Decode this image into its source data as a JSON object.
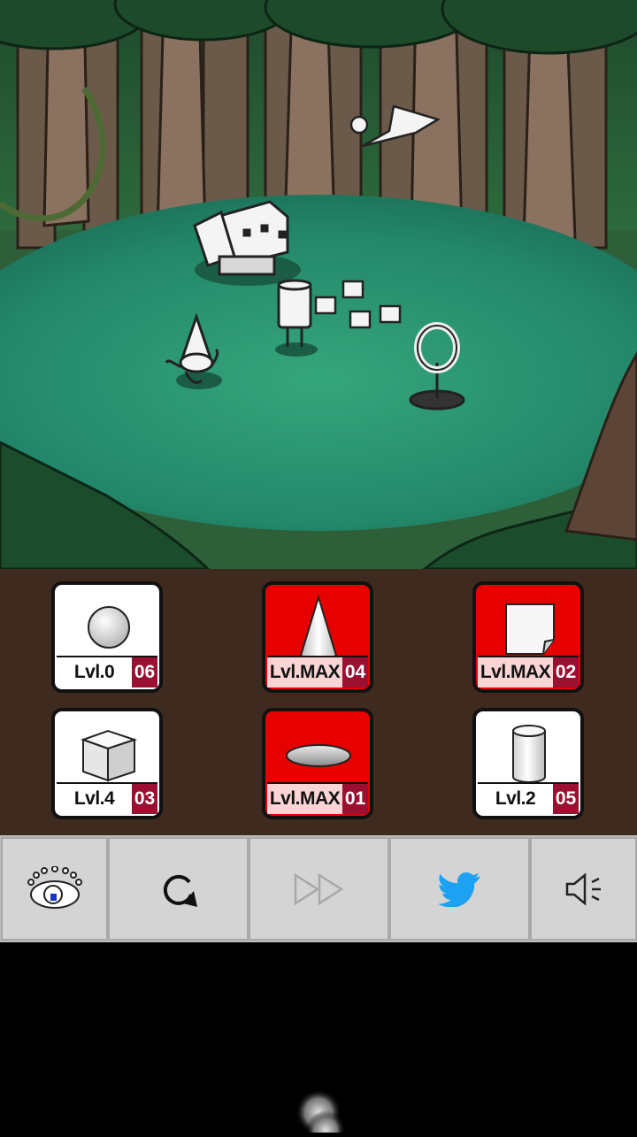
{
  "colors": {
    "panel_bg": "#3f2a1f",
    "card_max_bg": "#e60000",
    "count_badge": "#9b1030",
    "toolbar_bg": "#d4d4d4",
    "twitter_blue": "#1da1f2",
    "forest_floor": "#2a8f6a"
  },
  "shapes": [
    {
      "shape": "sphere",
      "level": "Lvl.0",
      "count": "06",
      "maxed": false
    },
    {
      "shape": "cone",
      "level": "Lvl.MAX",
      "count": "04",
      "maxed": true
    },
    {
      "shape": "paper",
      "level": "Lvl.MAX",
      "count": "02",
      "maxed": true
    },
    {
      "shape": "cube",
      "level": "Lvl.4",
      "count": "03",
      "maxed": false
    },
    {
      "shape": "disc",
      "level": "Lvl.MAX",
      "count": "01",
      "maxed": true
    },
    {
      "shape": "cylinder",
      "level": "Lvl.2",
      "count": "05",
      "maxed": false
    }
  ],
  "toolbar": {
    "buttons": [
      {
        "icon": "eye-logo-icon"
      },
      {
        "icon": "restart-icon"
      },
      {
        "icon": "fast-forward-icon",
        "disabled": true
      },
      {
        "icon": "twitter-icon"
      },
      {
        "icon": "speaker-icon"
      }
    ]
  },
  "scene": {
    "characters": [
      "cube-creature",
      "cone-squid",
      "cylinder-walker",
      "small-cubes",
      "ring-stand",
      "paper-bird"
    ]
  }
}
